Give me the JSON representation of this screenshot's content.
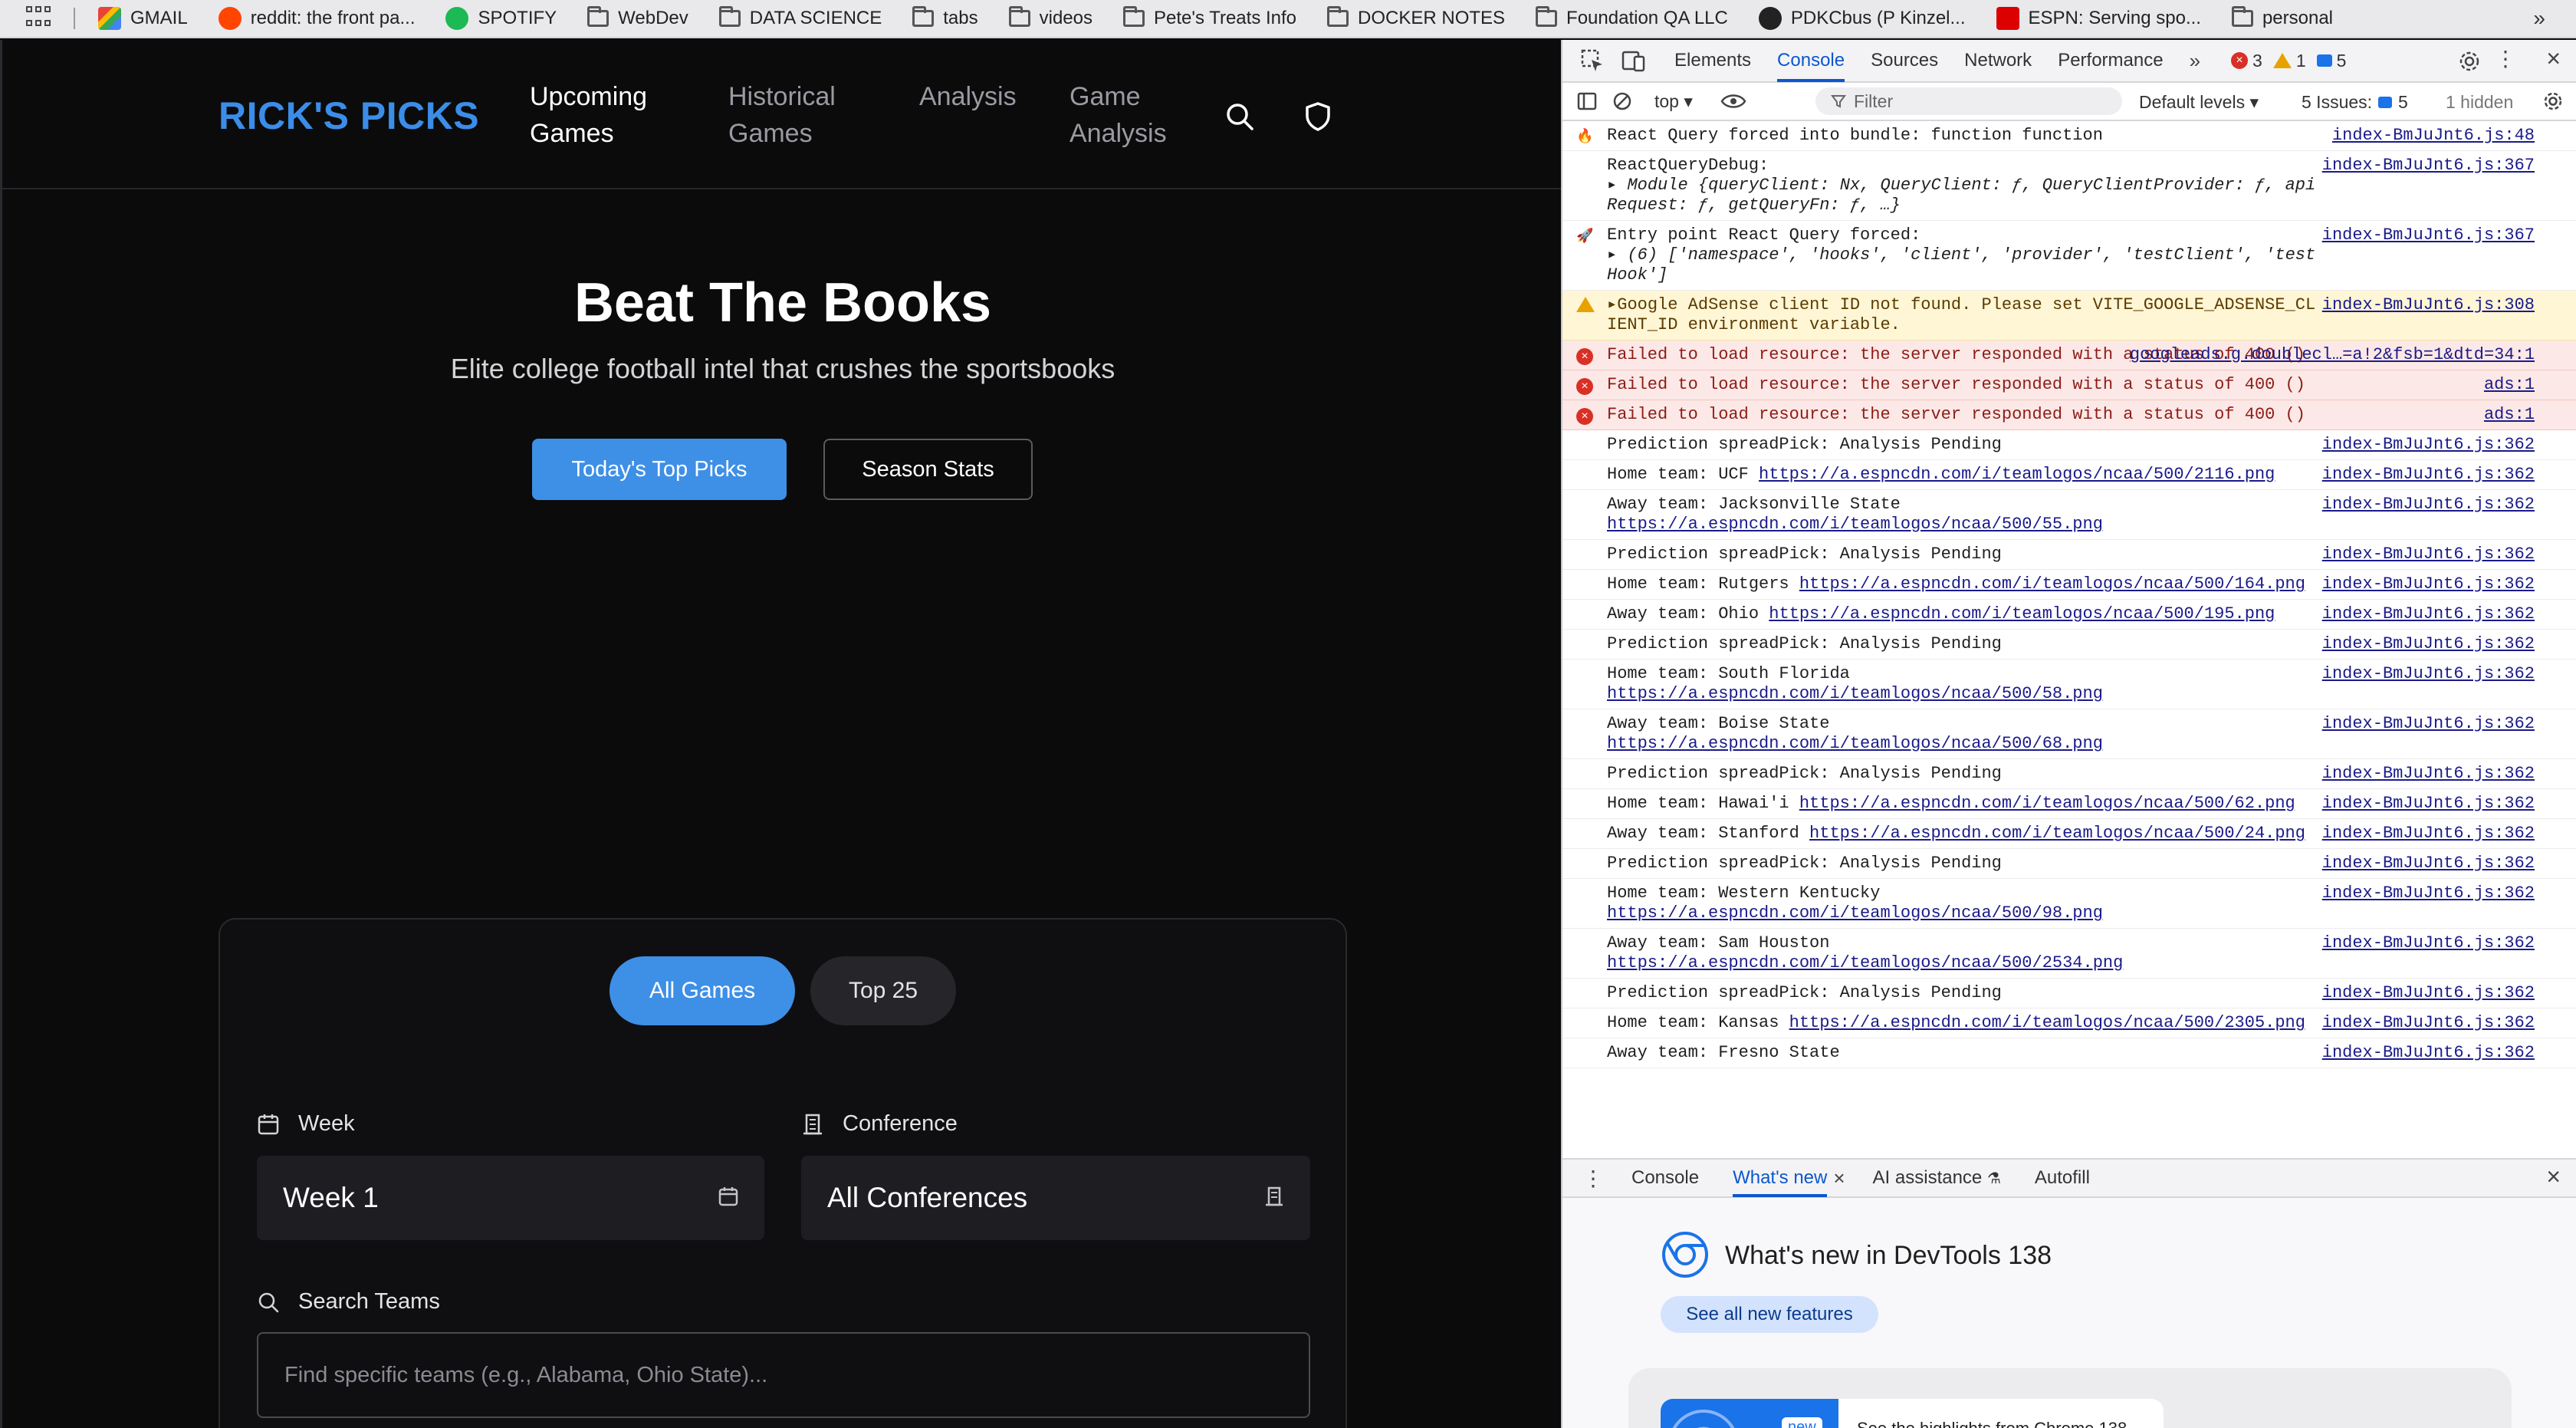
{
  "bookmarks": [
    {
      "label": "GMAIL",
      "icon": "gmail"
    },
    {
      "label": "reddit: the front pa...",
      "icon": "reddit"
    },
    {
      "label": "SPOTIFY",
      "icon": "spotify"
    },
    {
      "label": "WebDev",
      "icon": "folder"
    },
    {
      "label": "DATA SCIENCE",
      "icon": "folder"
    },
    {
      "label": "tabs",
      "icon": "folder"
    },
    {
      "label": "videos",
      "icon": "folder"
    },
    {
      "label": "Pete's Treats Info",
      "icon": "folder"
    },
    {
      "label": "DOCKER NOTES",
      "icon": "folder"
    },
    {
      "label": "Foundation QA LLC",
      "icon": "folder"
    },
    {
      "label": "PDKCbus (P Kinzel...",
      "icon": "github"
    },
    {
      "label": "ESPN: Serving spo...",
      "icon": "espn"
    },
    {
      "label": "personal",
      "icon": "folder"
    }
  ],
  "app": {
    "brand": "RICK'S PICKS",
    "nav": [
      {
        "line1": "Upcoming",
        "line2": "Games"
      },
      {
        "line1": "Historical",
        "line2": "Games"
      },
      {
        "line1": "Analysis",
        "line2": ""
      },
      {
        "line1": "Game",
        "line2": "Analysis"
      }
    ],
    "hero_title": "Beat The Books",
    "hero_subtitle": "Elite college football intel that crushes the sportsbooks",
    "primary_button": "Today's Top Picks",
    "secondary_button": "Season Stats",
    "filters": {
      "pill_all": "All Games",
      "pill_top": "Top 25",
      "week_label": "Week",
      "week_value": "Week 1",
      "conference_label": "Conference",
      "conference_value": "All Conferences",
      "search_label": "Search Teams",
      "search_placeholder": "Find specific teams (e.g., Alabama, Ohio State)..."
    },
    "accent": "#3e8fe6"
  },
  "devtools": {
    "tabs": [
      "Elements",
      "Console",
      "Sources",
      "Network",
      "Performance"
    ],
    "error_count": "3",
    "warn_count": "1",
    "info_count": "5",
    "toolbar": {
      "context": "top",
      "filter_placeholder": "Filter",
      "levels": "Default levels",
      "issues": "5 Issues:",
      "issues_count": "5",
      "hidden": "1 hidden"
    },
    "logs": [
      {
        "type": "log",
        "lead": "🔥",
        "text": "React Query forced into bundle: function function",
        "src": "index-BmJuJnt6.js:48"
      },
      {
        "type": "log",
        "lead": "",
        "text": "ReactQueryDebug:",
        "line2": "▸ Module {queryClient: Nx, QueryClient: ƒ, QueryClientProvider: ƒ, apiRequest: ƒ, getQueryFn: ƒ, …}",
        "src": "index-BmJuJnt6.js:367"
      },
      {
        "type": "log",
        "lead": "🚀",
        "text": "Entry point React Query forced:",
        "line2": "▸ (6) ['namespace', 'hooks', 'client', 'provider', 'testClient', 'testHook']",
        "src": "index-BmJuJnt6.js:367"
      },
      {
        "type": "warn",
        "lead": "",
        "text": "▸Google AdSense client ID not found. Please set VITE_GOOGLE_ADSENSE_CLIENT_ID environment variable.",
        "src": "index-BmJuJnt6.js:308"
      },
      {
        "type": "error",
        "lead": "",
        "text": "Failed to load resource: the server responded with a status of 400 ()",
        "src": "googleads.g.doublecl…=a!2&fsb=1&dtd=34:1"
      },
      {
        "type": "error",
        "lead": "",
        "text": "Failed to load resource: the server responded with a status of 400 ()",
        "src": "ads:1"
      },
      {
        "type": "error",
        "lead": "",
        "text": "Failed to load resource: the server responded with a status of 400 ()",
        "src": "ads:1"
      },
      {
        "type": "log",
        "lead": "",
        "text": "Prediction spreadPick: Analysis Pending",
        "src": "index-BmJuJnt6.js:362"
      },
      {
        "type": "log",
        "lead": "",
        "text": "Home team: UCF",
        "url": "https://a.espncdn.com/i/teamlogos/ncaa/500/2116.png",
        "src": "index-BmJuJnt6.js:362"
      },
      {
        "type": "log",
        "lead": "",
        "text": "Away team: Jacksonville State",
        "url": "https://a.espncdn.com/i/teamlogos/ncaa/500/55.png",
        "wrap": true,
        "src": "index-BmJuJnt6.js:362"
      },
      {
        "type": "log",
        "lead": "",
        "text": "Prediction spreadPick: Analysis Pending",
        "src": "index-BmJuJnt6.js:362"
      },
      {
        "type": "log",
        "lead": "",
        "text": "Home team: Rutgers",
        "url": "https://a.espncdn.com/i/teamlogos/ncaa/500/164.png",
        "src": "index-BmJuJnt6.js:362"
      },
      {
        "type": "log",
        "lead": "",
        "text": "Away team: Ohio",
        "url": "https://a.espncdn.com/i/teamlogos/ncaa/500/195.png",
        "src": "index-BmJuJnt6.js:362"
      },
      {
        "type": "log",
        "lead": "",
        "text": "Prediction spreadPick: Analysis Pending",
        "src": "index-BmJuJnt6.js:362"
      },
      {
        "type": "log",
        "lead": "",
        "text": "Home team: South Florida",
        "url": "https://a.espncdn.com/i/teamlogos/ncaa/500/58.png",
        "wrap": true,
        "src": "index-BmJuJnt6.js:362"
      },
      {
        "type": "log",
        "lead": "",
        "text": "Away team: Boise State",
        "url": "https://a.espncdn.com/i/teamlogos/ncaa/500/68.png",
        "wrap": true,
        "src": "index-BmJuJnt6.js:362"
      },
      {
        "type": "log",
        "lead": "",
        "text": "Prediction spreadPick: Analysis Pending",
        "src": "index-BmJuJnt6.js:362"
      },
      {
        "type": "log",
        "lead": "",
        "text": "Home team: Hawai'i",
        "url": "https://a.espncdn.com/i/teamlogos/ncaa/500/62.png",
        "src": "index-BmJuJnt6.js:362"
      },
      {
        "type": "log",
        "lead": "",
        "text": "Away team: Stanford",
        "url": "https://a.espncdn.com/i/teamlogos/ncaa/500/24.png",
        "src": "index-BmJuJnt6.js:362"
      },
      {
        "type": "log",
        "lead": "",
        "text": "Prediction spreadPick: Analysis Pending",
        "src": "index-BmJuJnt6.js:362"
      },
      {
        "type": "log",
        "lead": "",
        "text": "Home team: Western Kentucky",
        "url": "https://a.espncdn.com/i/teamlogos/ncaa/500/98.png",
        "wrap": true,
        "src": "index-BmJuJnt6.js:362"
      },
      {
        "type": "log",
        "lead": "",
        "text": "Away team: Sam Houston",
        "url": "https://a.espncdn.com/i/teamlogos/ncaa/500/2534.png",
        "wrap": true,
        "src": "index-BmJuJnt6.js:362"
      },
      {
        "type": "log",
        "lead": "",
        "text": "Prediction spreadPick: Analysis Pending",
        "src": "index-BmJuJnt6.js:362"
      },
      {
        "type": "log",
        "lead": "",
        "text": "Home team: Kansas",
        "url": "https://a.espncdn.com/i/teamlogos/ncaa/500/2305.png",
        "src": "index-BmJuJnt6.js:362"
      },
      {
        "type": "log",
        "lead": "",
        "text": "Away team: Fresno State",
        "src": "index-BmJuJnt6.js:362"
      }
    ],
    "drawer_tabs": [
      "Console",
      "What's new",
      "AI assistance",
      "Autofill"
    ],
    "whats_new_title": "What's new in DevTools 138",
    "whats_new_button": "See all new features",
    "card_badge": "new",
    "card_text": "See the highlights from Chrome 138"
  }
}
